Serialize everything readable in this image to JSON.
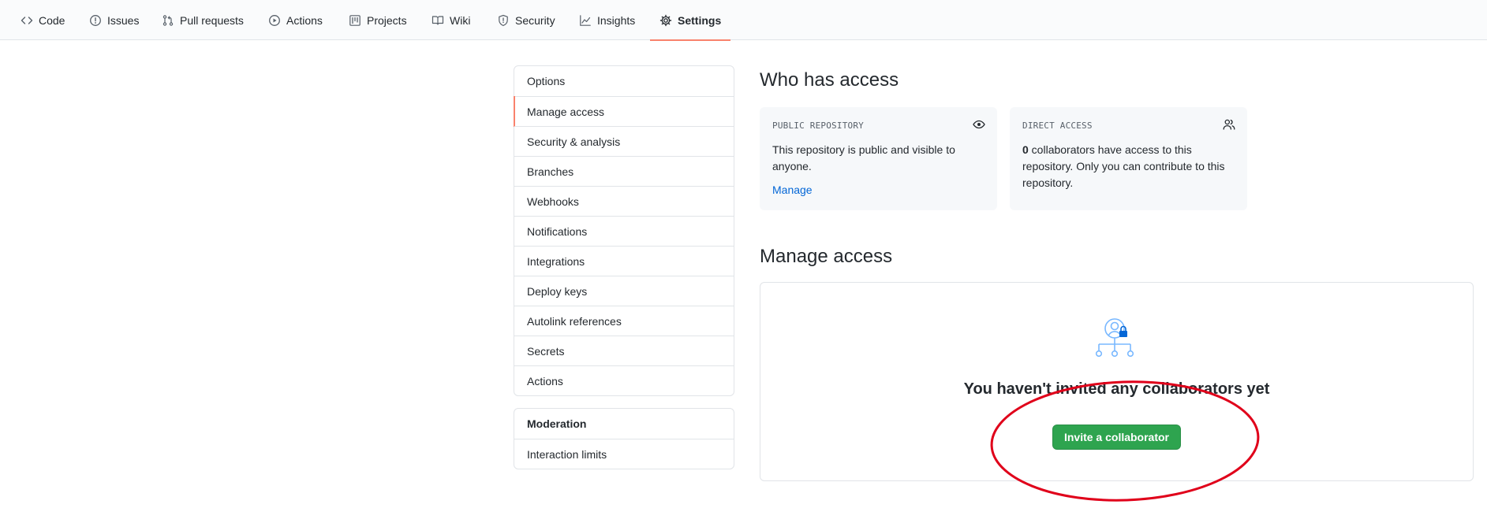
{
  "repo_nav": {
    "items": [
      {
        "label": "Code",
        "icon": "code-icon"
      },
      {
        "label": "Issues",
        "icon": "issue-opened-icon"
      },
      {
        "label": "Pull requests",
        "icon": "git-pull-request-icon"
      },
      {
        "label": "Actions",
        "icon": "play-icon"
      },
      {
        "label": "Projects",
        "icon": "project-icon"
      },
      {
        "label": "Wiki",
        "icon": "book-icon"
      },
      {
        "label": "Security",
        "icon": "shield-icon"
      },
      {
        "label": "Insights",
        "icon": "graph-icon"
      },
      {
        "label": "Settings",
        "icon": "gear-icon"
      }
    ],
    "selected": "Settings"
  },
  "settings_menu": {
    "items": [
      {
        "label": "Options"
      },
      {
        "label": "Manage access"
      },
      {
        "label": "Security & analysis"
      },
      {
        "label": "Branches"
      },
      {
        "label": "Webhooks"
      },
      {
        "label": "Notifications"
      },
      {
        "label": "Integrations"
      },
      {
        "label": "Deploy keys"
      },
      {
        "label": "Autolink references"
      },
      {
        "label": "Secrets"
      },
      {
        "label": "Actions"
      }
    ],
    "active": "Manage access"
  },
  "moderation_menu": {
    "heading": "Moderation",
    "items": [
      {
        "label": "Interaction limits"
      }
    ]
  },
  "who_has_access": {
    "heading": "Who has access",
    "public_box": {
      "title": "PUBLIC REPOSITORY",
      "text": "This repository is public and visible to anyone.",
      "link": "Manage",
      "icon": "eye-icon"
    },
    "direct_box": {
      "title": "DIRECT ACCESS",
      "count": "0",
      "text": " collaborators have access to this repository. Only you can contribute to this repository.",
      "icon": "people-icon"
    }
  },
  "manage_access": {
    "heading": "Manage access",
    "blankslate_title": "You haven't invited any collaborators yet",
    "invite_button": "Invite a collaborator",
    "illustration_icon": "collaborators-lock-icon"
  },
  "colors": {
    "accent_underline": "#f9826c",
    "link": "#0366d6",
    "button_green": "#2ea44f",
    "annotation_red": "#e0001a"
  }
}
